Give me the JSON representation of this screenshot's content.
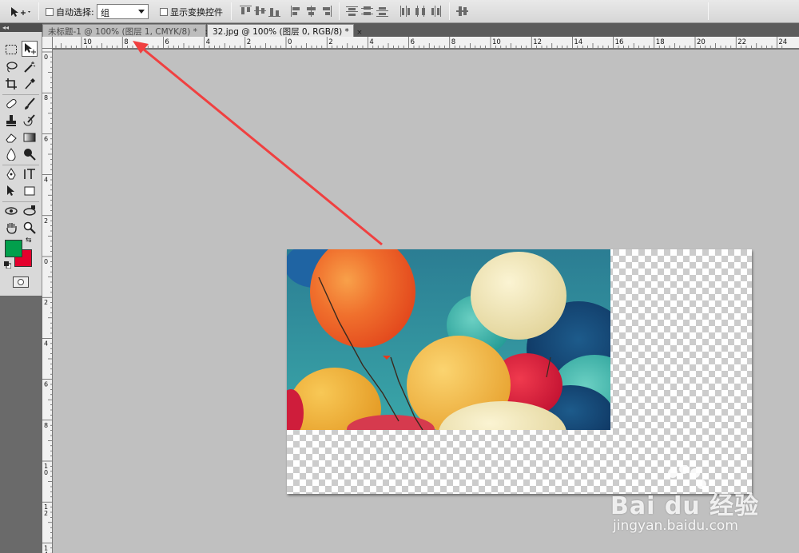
{
  "options_bar": {
    "tool_icon": "move-tool-icon",
    "auto_select_label": "自动选择:",
    "auto_select_value": "组",
    "show_transform_label": "显示变换控件"
  },
  "tabs": [
    {
      "label": "未标题-1 @ 100% (图层 1, CMYK/8) *",
      "active": false
    },
    {
      "label": "32.jpg @ 100% (图层 0, RGB/8) *",
      "active": true
    }
  ],
  "tab_close_glyph": "×",
  "tools_panel_header": "◂◂",
  "tools": [
    [
      "marquee-icon",
      "move-icon"
    ],
    [
      "lasso-icon",
      "magic-wand-icon"
    ],
    [
      "crop-icon",
      "eyedropper-icon"
    ],
    [
      "healing-brush-icon",
      "brush-icon"
    ],
    [
      "clone-stamp-icon",
      "history-brush-icon"
    ],
    [
      "eraser-icon",
      "gradient-icon"
    ],
    [
      "blur-icon",
      "dodge-icon"
    ],
    [
      "pen-icon",
      "type-icon"
    ],
    [
      "path-select-icon",
      "shape-icon"
    ],
    [
      "3d-rotate-icon",
      "3d-orbit-icon"
    ],
    [
      "hand-icon",
      "zoom-icon"
    ]
  ],
  "colors": {
    "foreground": "#029f4c",
    "background": "#e4002d",
    "arrow": "#f04040"
  },
  "ruler_top_numbers": [
    "10",
    "8",
    "6",
    "4",
    "2",
    "0",
    "2",
    "4",
    "6",
    "8",
    "10",
    "12",
    "14",
    "16",
    "18",
    "20",
    "22",
    "24"
  ],
  "ruler_left_numbers": [
    "0",
    "8",
    "6",
    "4",
    "2",
    "0",
    "2",
    "4",
    "6",
    "8",
    "10",
    "12",
    "14"
  ],
  "watermark": {
    "logo": "Bai du 经验",
    "url": "jingyan.baidu.com"
  }
}
